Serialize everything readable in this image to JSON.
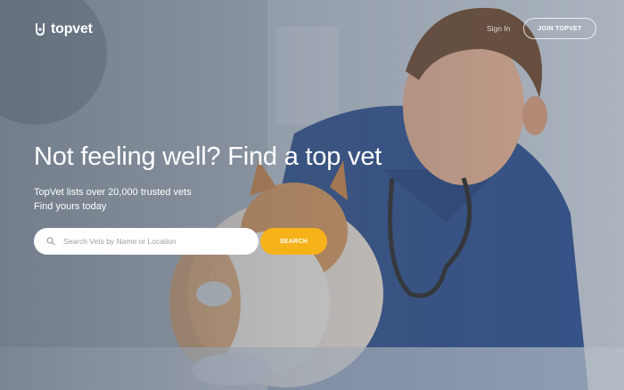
{
  "brand": {
    "name": "topvet",
    "logo_icon": "vet-logo-icon"
  },
  "header": {
    "signin_label": "Sign In",
    "join_label": "JOIN TOPVET"
  },
  "hero": {
    "headline": "Not feeling well? Find a top vet",
    "subline_1": "TopVet lists over 20,000 trusted vets",
    "subline_2": "Find yours today"
  },
  "search": {
    "placeholder": "Search Vets by Name or Location",
    "value": "",
    "button_label": "SEARCH",
    "icon": "search-icon"
  },
  "colors": {
    "accent": "#f7b21a",
    "text": "#ffffff"
  }
}
